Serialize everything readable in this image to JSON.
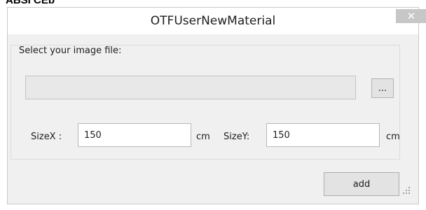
{
  "top_caption": "ABSI CEb",
  "window": {
    "title": "OTFUserNewMaterial",
    "close_glyph": "✕"
  },
  "group": {
    "label": "Select your image file:"
  },
  "file": {
    "path_value": "",
    "browse_label": "..."
  },
  "size_x": {
    "label": "SizeX :",
    "value": "150",
    "unit": "cm"
  },
  "size_y": {
    "label": "SizeY:",
    "value": "150",
    "unit": "cm"
  },
  "actions": {
    "add_label": "add"
  },
  "icons": {
    "close": "close-icon",
    "grip": "resize-grip-icon"
  }
}
